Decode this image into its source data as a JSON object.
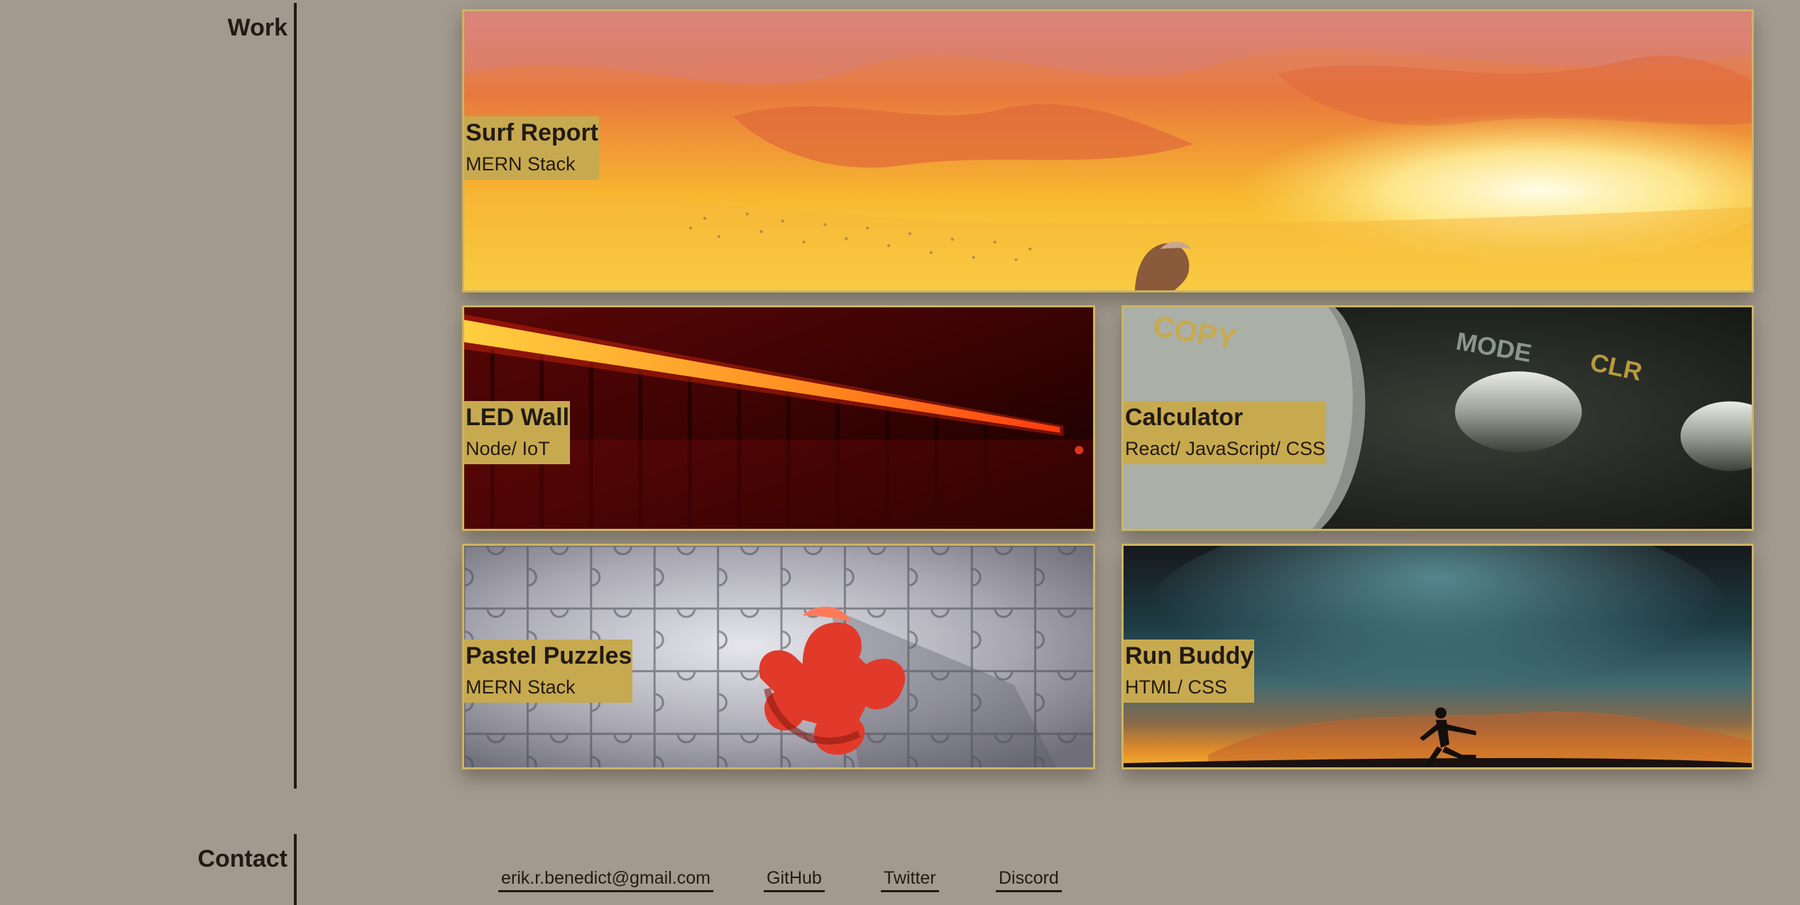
{
  "sections": {
    "work_heading": "Work",
    "contact_heading": "Contact"
  },
  "projects": [
    {
      "title": "Surf Report",
      "stack": "MERN Stack"
    },
    {
      "title": "LED Wall",
      "stack": "Node/ IoT"
    },
    {
      "title": "Calculator",
      "stack": "React/ JavaScript/ CSS"
    },
    {
      "title": "Pastel Puzzles",
      "stack": "MERN Stack"
    },
    {
      "title": "Run Buddy",
      "stack": "HTML/ CSS"
    }
  ],
  "contact": {
    "links": [
      {
        "label": "erik.r.benedict@gmail.com"
      },
      {
        "label": "GitHub"
      },
      {
        "label": "Twitter"
      },
      {
        "label": "Discord"
      }
    ]
  },
  "colors": {
    "page_background": "#a29a8e",
    "text": "#231a14",
    "card_border": "#cdb462",
    "label_background": "#c7aa4f"
  }
}
